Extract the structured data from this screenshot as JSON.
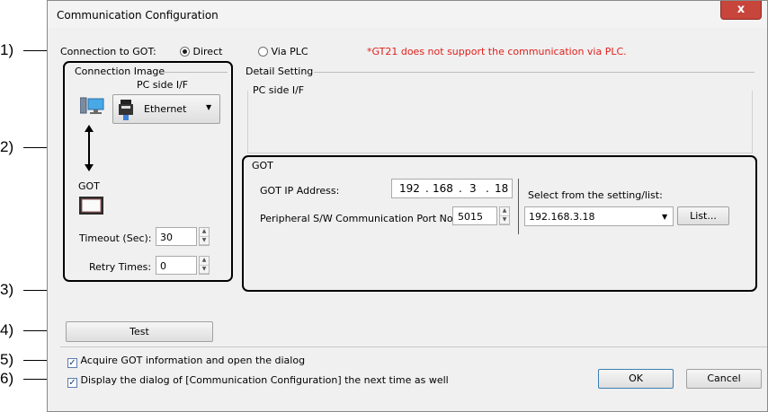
{
  "window": {
    "title": "Communication Configuration",
    "close_glyph": "x"
  },
  "callouts": [
    "1)",
    "2)",
    "3)",
    "4)",
    "5)",
    "6)"
  ],
  "connection": {
    "label": "Connection to GOT:",
    "direct_label": "Direct",
    "via_plc_label": "Via PLC",
    "warning": "*GT21 does not support the communication via PLC.",
    "warning_color": "#e0201c"
  },
  "connection_image": {
    "group_label": "Connection Image",
    "pc_side_label": "PC side I/F",
    "interface_value": "Ethernet",
    "got_label": "GOT",
    "timeout_label": "Timeout (Sec):",
    "timeout_value": "30",
    "retry_label": "Retry Times:",
    "retry_value": "0"
  },
  "detail": {
    "group_label": "Detail Setting",
    "pc_side_label": "PC side I/F",
    "got_group_label": "GOT",
    "ip_label": "GOT IP Address:",
    "ip_octets": [
      "192",
      "168",
      "3",
      "18"
    ],
    "port_label": "Peripheral S/W Communication Port No.:",
    "port_value": "5015",
    "select_label": "Select from the setting/list:",
    "select_value": "192.168.3.18",
    "list_button": "List..."
  },
  "actions": {
    "test_button": "Test",
    "acquire_label": "Acquire GOT information and open the dialog",
    "display_label": "Display the dialog of [Communication Configuration] the next time as well",
    "ok_button": "OK",
    "cancel_button": "Cancel"
  },
  "icons": [
    "pc-icon",
    "ethernet-device-icon",
    "dropdown-arrow-icon",
    "double-arrow-icon",
    "got-device-icon",
    "spin-up-icon",
    "spin-down-icon",
    "close-icon"
  ]
}
